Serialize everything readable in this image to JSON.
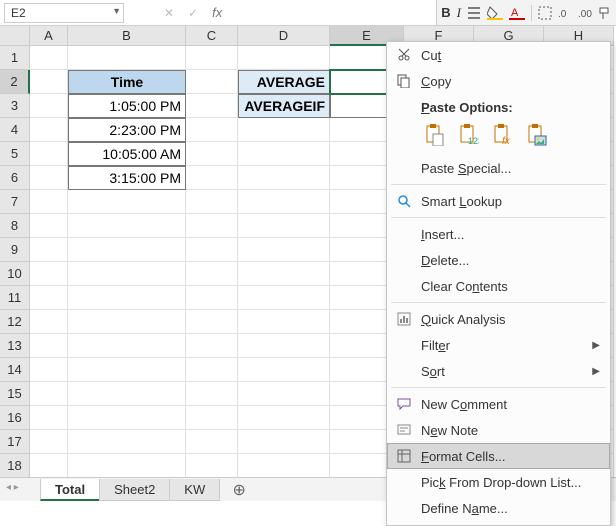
{
  "namebox": {
    "value": "E2"
  },
  "fx": {
    "label": "fx"
  },
  "toolbar": {
    "bold": "B",
    "italic": "I"
  },
  "columns": [
    {
      "label": "A",
      "width": 38
    },
    {
      "label": "B",
      "width": 118
    },
    {
      "label": "C",
      "width": 52
    },
    {
      "label": "D",
      "width": 92
    },
    {
      "label": "E",
      "width": 74
    },
    {
      "label": "F",
      "width": 70
    },
    {
      "label": "G",
      "width": 70
    },
    {
      "label": "H",
      "width": 70
    }
  ],
  "selected_col_index": 4,
  "row_count": 18,
  "selected_row": 2,
  "cells": {
    "B2": "Time",
    "B3": "1:05:00 PM",
    "B4": "2:23:00 PM",
    "B5": "10:05:00 AM",
    "B6": "3:15:00 PM",
    "D2": "AVERAGE",
    "D3": "AVERAGEIF"
  },
  "tabs": {
    "items": [
      {
        "label": "Total",
        "active": true
      },
      {
        "label": "Sheet2",
        "active": false
      },
      {
        "label": "KW",
        "active": false
      }
    ]
  },
  "ctx": {
    "cut": "Cu<u>t</u>",
    "copy": "<u>C</u>opy",
    "paste_header": "<u>P</u>aste Options:",
    "paste_special": "Paste <u>S</u>pecial...",
    "smart_lookup": "Smart <u>L</u>ookup",
    "insert": "<u>I</u>nsert...",
    "delete": "<u>D</u>elete...",
    "clear": "Clear Co<u>n</u>tents",
    "quick": "<u>Q</u>uick Analysis",
    "filter": "Filt<u>e</u>r",
    "sort": "S<u>o</u>rt",
    "new_comment": "New C<u>o</u>mment",
    "new_note": "N<u>e</u>w Note",
    "format_cells": "<u>F</u>ormat Cells...",
    "pick": "Pic<u>k</u> From Drop-down List...",
    "define_name": "Define N<u>a</u>me..."
  }
}
